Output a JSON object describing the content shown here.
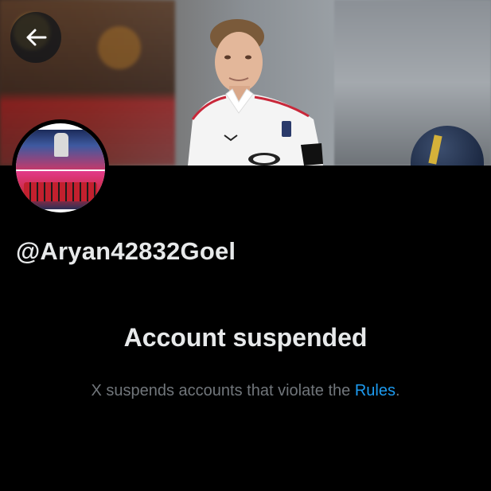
{
  "profile": {
    "handle": "@Aryan42832Goel"
  },
  "suspension": {
    "title": "Account suspended",
    "message_prefix": "X suspends accounts that violate the ",
    "rules_link": "Rules",
    "message_suffix": "."
  },
  "icons": {
    "back": "arrow-left-icon"
  },
  "colors": {
    "background": "#000000",
    "text_primary": "#e7e9ea",
    "text_secondary": "#71767b",
    "link": "#1d9bf0"
  }
}
